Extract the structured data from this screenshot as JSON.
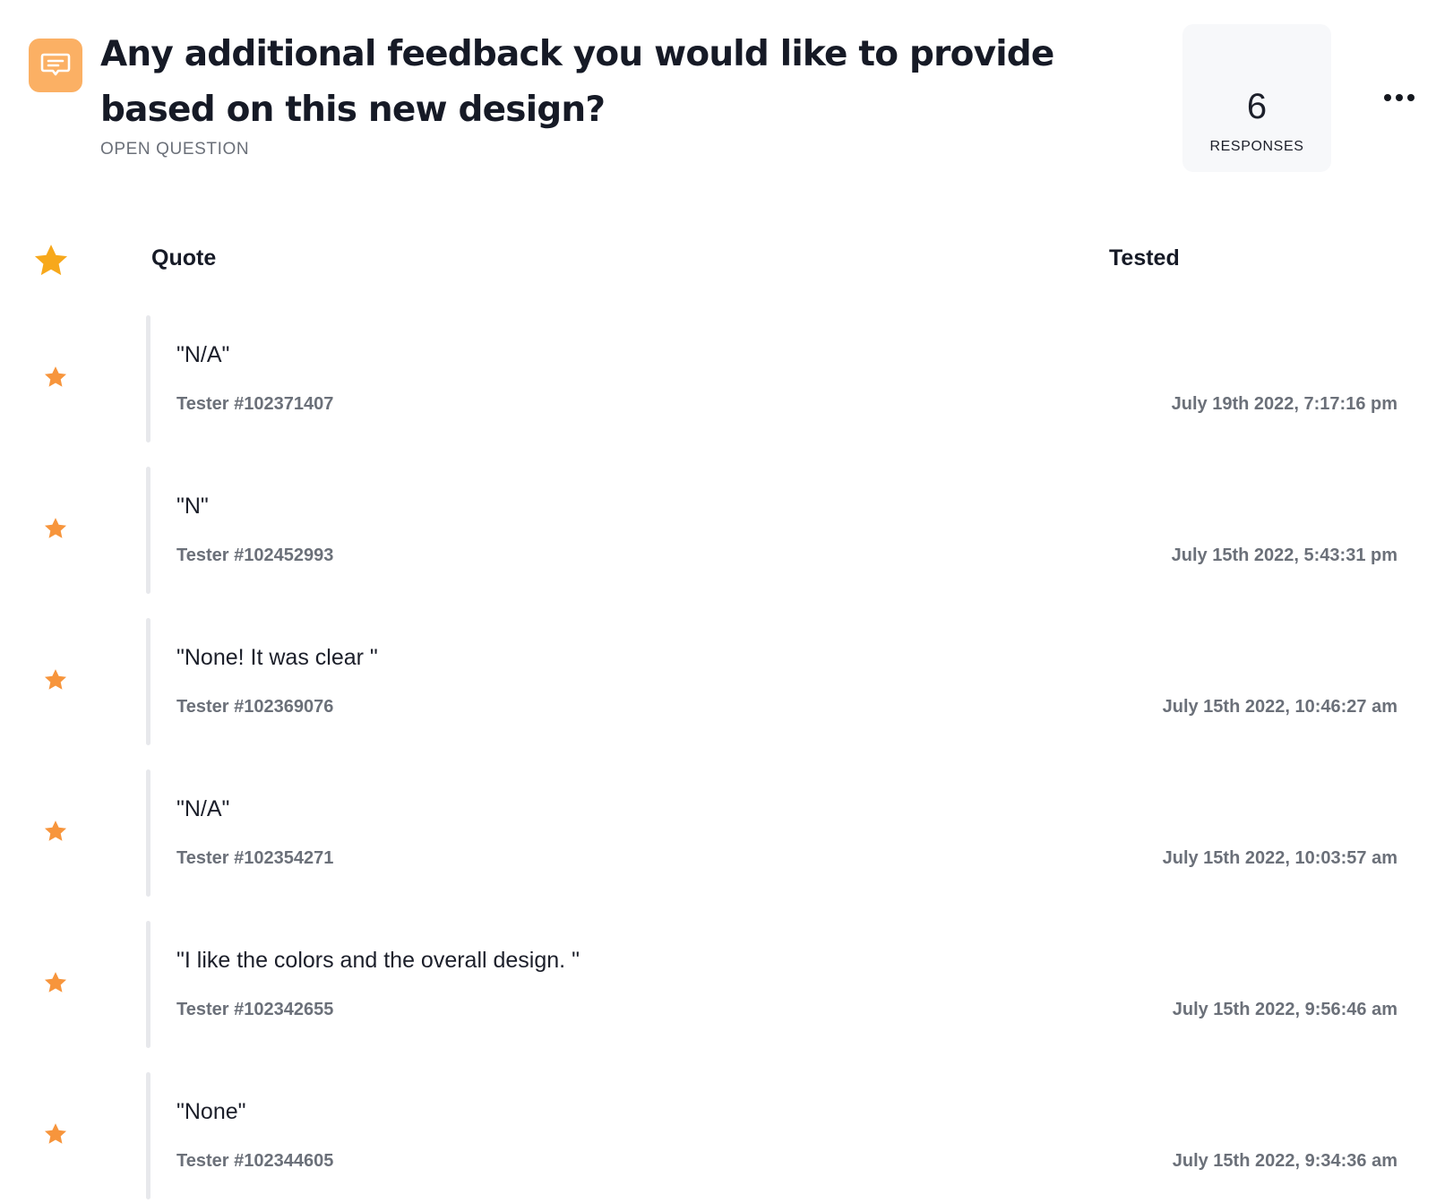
{
  "question": {
    "title": "Any additional feedback you would like to provide based on this new design?",
    "type": "OPEN QUESTION",
    "icon": "chat-bubble-icon"
  },
  "responses": {
    "count": "6",
    "label": "RESPONSES"
  },
  "table": {
    "headers": {
      "quote": "Quote",
      "tested": "Tested"
    },
    "rows": [
      {
        "quote": "\"N/A\"",
        "tester": "Tester #102371407",
        "date": "July 19th 2022, 7:17:16 pm"
      },
      {
        "quote": "\"N\"",
        "tester": "Tester #102452993",
        "date": "July 15th 2022, 5:43:31 pm"
      },
      {
        "quote": "\"None! It was clear \"",
        "tester": "Tester #102369076",
        "date": "July 15th 2022, 10:46:27 am"
      },
      {
        "quote": "\"N/A\"",
        "tester": "Tester #102354271",
        "date": "July 15th 2022, 10:03:57 am"
      },
      {
        "quote": "\"I like the colors and the overall design. \"",
        "tester": "Tester #102342655",
        "date": "July 15th 2022, 9:56:46 am"
      },
      {
        "quote": "\"None\"",
        "tester": "Tester #102344605",
        "date": "July 15th 2022, 9:34:36 am"
      }
    ]
  },
  "colors": {
    "accent": "#fbb064",
    "star_header": "#f7a81b",
    "star_row": "#f7953c",
    "muted_text": "#6b7079",
    "row_bar": "#e7e8ec"
  }
}
